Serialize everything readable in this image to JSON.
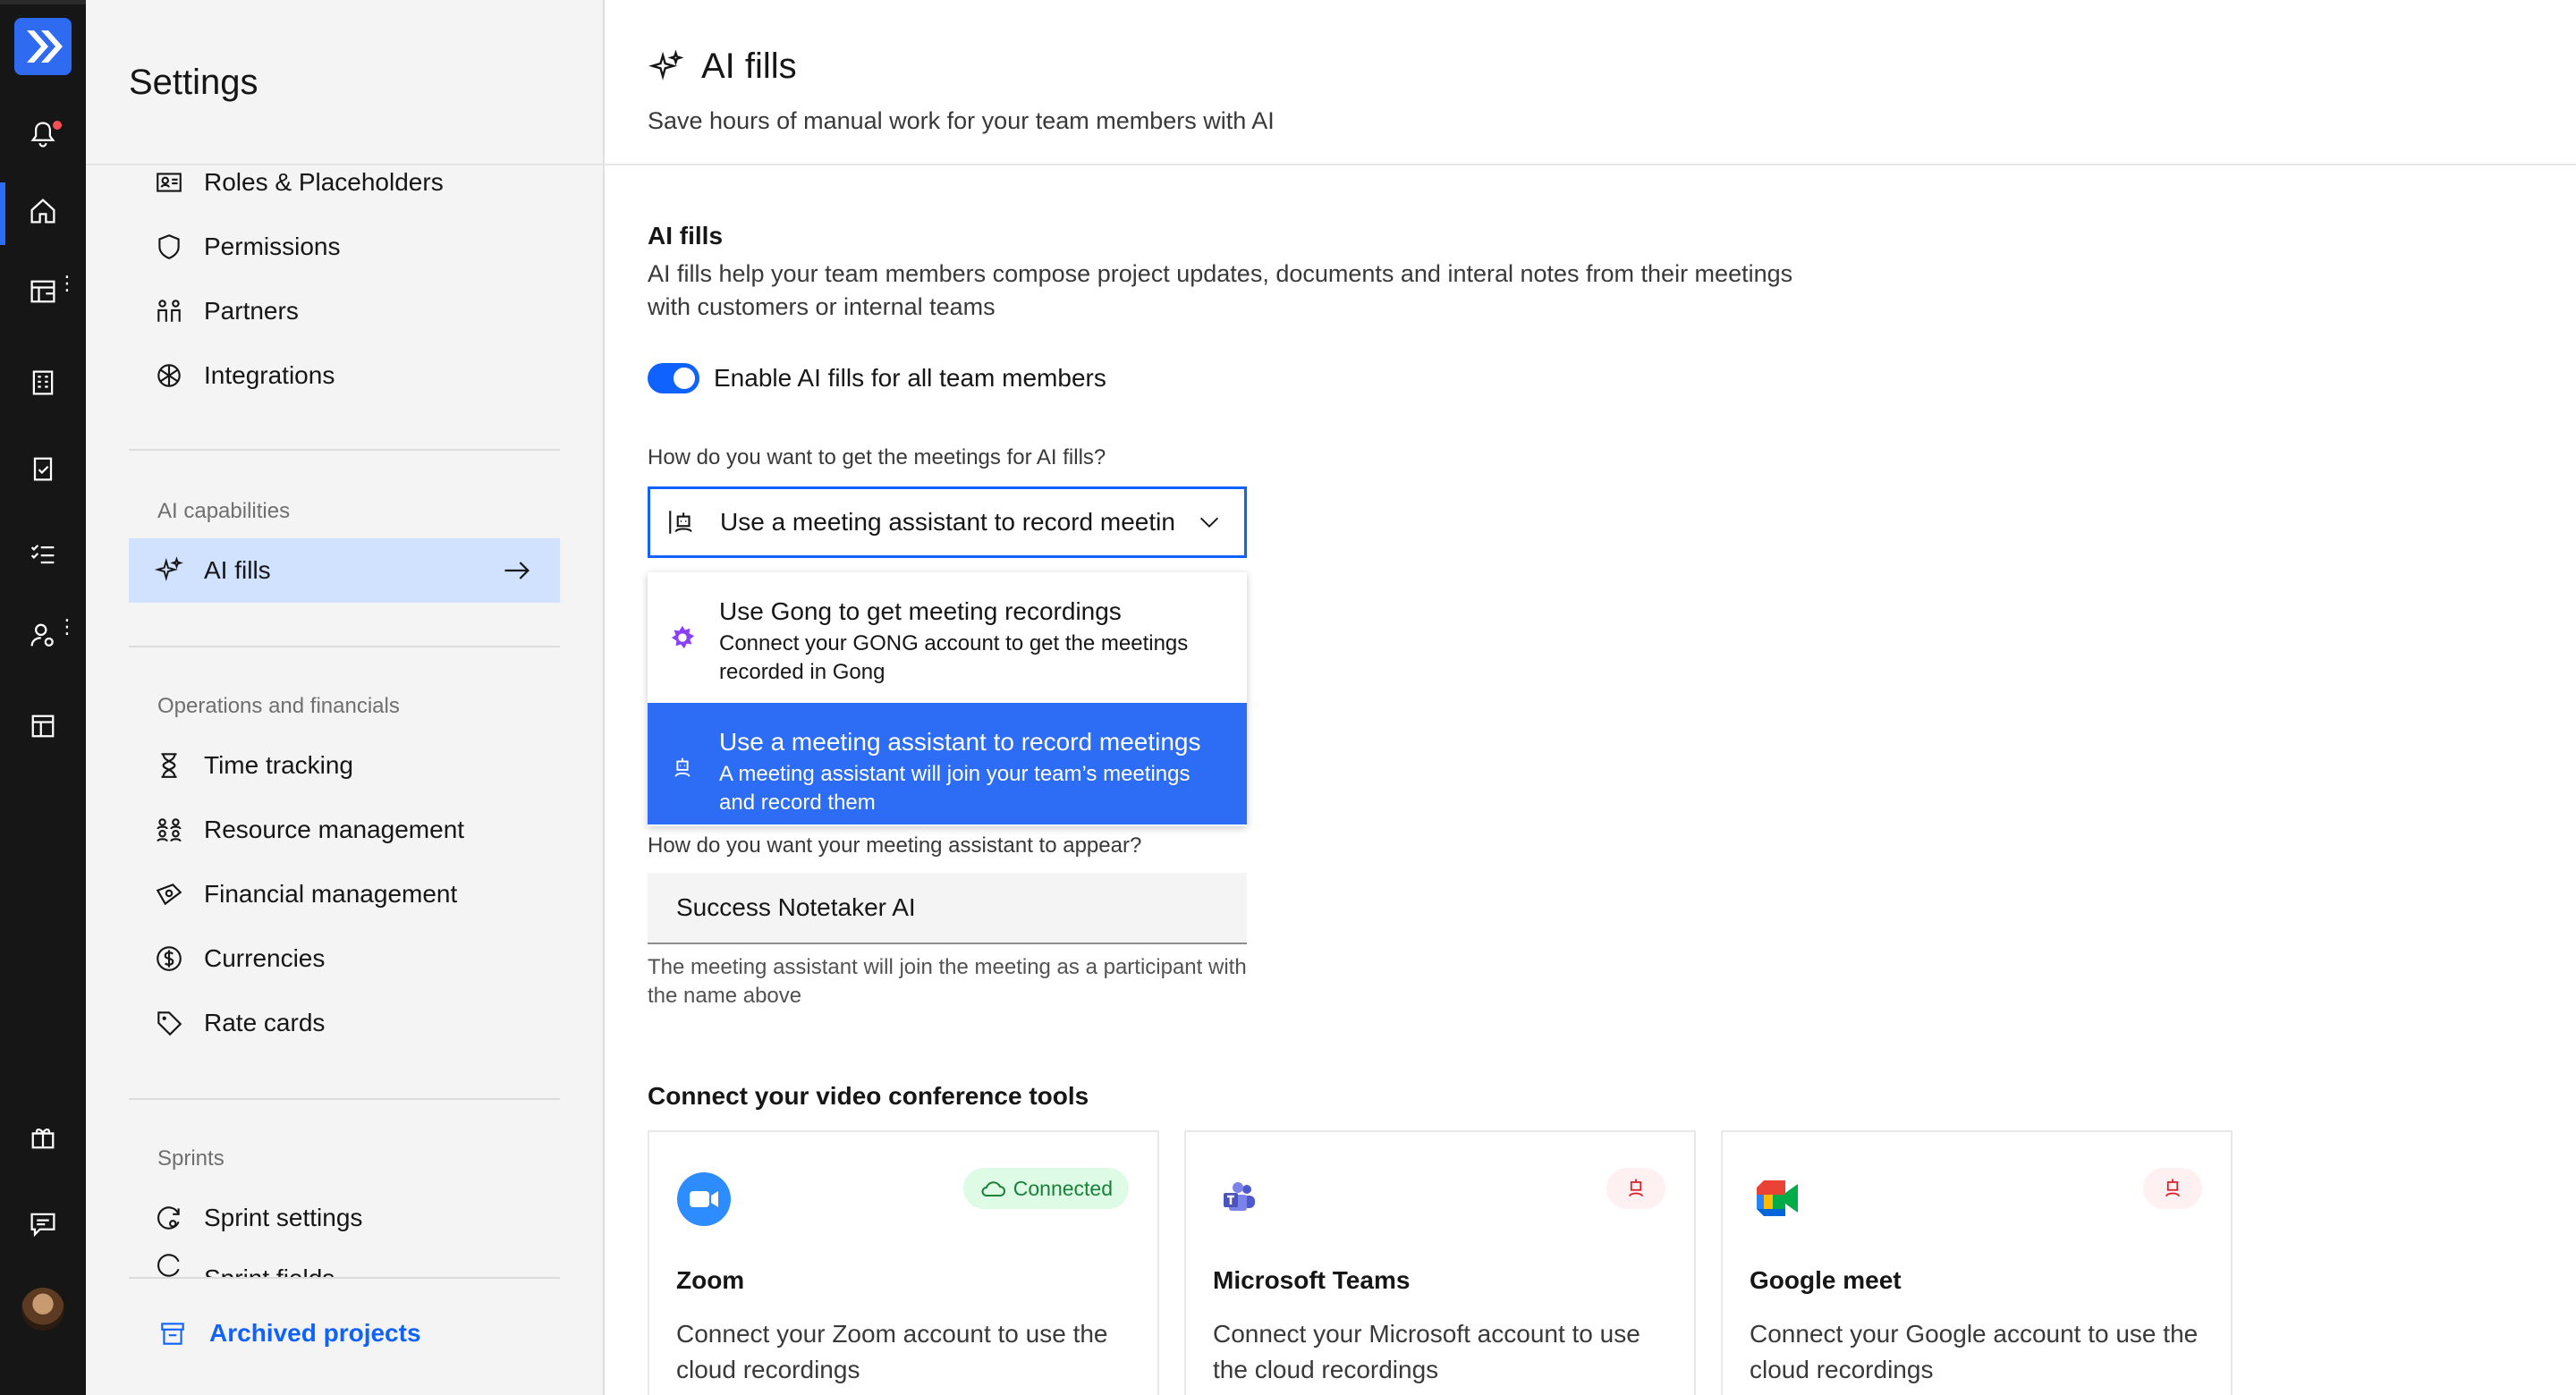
{
  "rail": {
    "items": [
      {
        "icon": "notification-icon"
      },
      {
        "icon": "home-icon"
      },
      {
        "icon": "calendar-grid-icon"
      },
      {
        "icon": "building-icon"
      },
      {
        "icon": "clipboard-icon"
      },
      {
        "icon": "checklist-icon"
      },
      {
        "icon": "user-settings-icon"
      },
      {
        "icon": "layout-icon"
      },
      {
        "icon": "gift-icon"
      },
      {
        "icon": "chat-icon"
      }
    ]
  },
  "sidebar": {
    "title": "Settings",
    "items_top": [
      {
        "label": "Roles & Placeholders",
        "icon": "roles-icon"
      },
      {
        "label": "Permissions",
        "icon": "shield-icon"
      },
      {
        "label": "Partners",
        "icon": "partners-icon"
      },
      {
        "label": "Integrations",
        "icon": "integrations-icon"
      }
    ],
    "group_ai": "AI capabilities",
    "ai_item": {
      "label": "AI fills",
      "icon": "sparkle-icon"
    },
    "group_ops": "Operations and financials",
    "items_ops": [
      {
        "label": "Time tracking",
        "icon": "hourglass-icon"
      },
      {
        "label": "Resource management",
        "icon": "people-icon"
      },
      {
        "label": "Financial management",
        "icon": "money-icon"
      },
      {
        "label": "Currencies",
        "icon": "currency-icon"
      },
      {
        "label": "Rate cards",
        "icon": "tag-icon"
      }
    ],
    "group_sprints": "Sprints",
    "items_sprints": [
      {
        "label": "Sprint settings",
        "icon": "sprint-icon"
      },
      {
        "label": "Sprint fields",
        "icon": "sprint-fields-icon"
      }
    ],
    "archived": "Archived projects"
  },
  "main": {
    "title": "AI fills",
    "subtitle": "Save hours of manual work for your team members with AI",
    "section_title": "AI fills",
    "section_desc": "AI fills help your team members compose project updates, documents and interal notes from their meetings with customers or internal teams",
    "toggle_label": "Enable AI fills for all team members",
    "toggle_on": true,
    "question_meetings": "How do you want to get the meetings for AI fills?",
    "select_value": "Use a meeting assistant to record meetin",
    "options": [
      {
        "title": "Use Gong to get meeting recordings",
        "desc": "Connect your GONG account to get the meetings recorded in Gong",
        "icon": "gong-icon",
        "selected": false
      },
      {
        "title": "Use a meeting assistant to record meetings",
        "desc": "A meeting assistant will join your team’s meetings and record them",
        "icon": "assistant-icon",
        "selected": true
      }
    ],
    "question_appear": "How do you want your meeting assistant to appear?",
    "assistant_name": "Success Notetaker AI",
    "helper": "The meeting assistant will join the meeting as a participant with the name above",
    "connect_title": "Connect your video conference tools",
    "cards": [
      {
        "name": "Zoom",
        "desc": "Connect your Zoom account to use the cloud recordings",
        "status": "Connected",
        "icon": "zoom-icon"
      },
      {
        "name": "Microsoft Teams",
        "desc": "Connect your Microsoft account to use the cloud recordings",
        "status": "",
        "icon": "teams-icon"
      },
      {
        "name": "Google meet",
        "desc": "Connect your Google account to use the cloud recordings",
        "status": "",
        "icon": "google-meet-icon"
      }
    ]
  },
  "colors": {
    "rail_bg": "#161616",
    "accent": "#0f62fe",
    "selected_option": "#2d6cf5",
    "active_nav": "#d0e2ff",
    "connected_bg": "#defbe6",
    "connected_text": "#198038"
  }
}
